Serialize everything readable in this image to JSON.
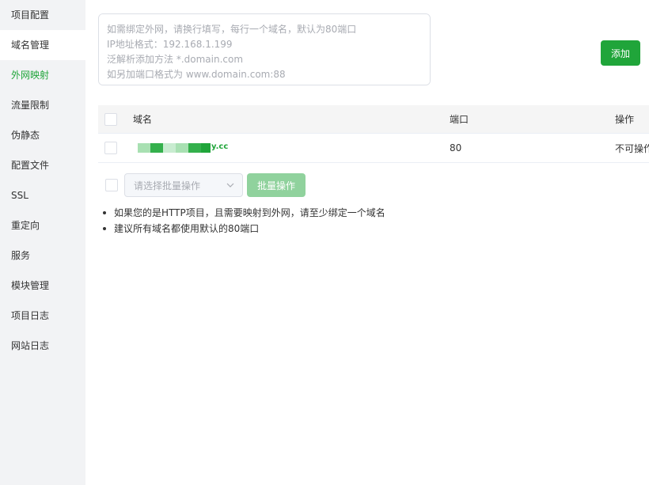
{
  "sidebar": {
    "items": [
      {
        "label": "项目配置"
      },
      {
        "label": "域名管理"
      },
      {
        "label": "外网映射"
      },
      {
        "label": "流量限制"
      },
      {
        "label": "伪静态"
      },
      {
        "label": "配置文件"
      },
      {
        "label": "SSL"
      },
      {
        "label": "重定向"
      },
      {
        "label": "服务"
      },
      {
        "label": "模块管理"
      },
      {
        "label": "项目日志"
      },
      {
        "label": "网站日志"
      }
    ],
    "selected_item": "域名管理",
    "highlighted_item": "外网映射"
  },
  "domain_input": {
    "placeholder": "如需绑定外网，请换行填写，每行一个域名，默认为80端口\nIP地址格式：192.168.1.199\n泛解析添加方法 *.domain.com\n如另加端口格式为 www.domain.com:88",
    "value": ""
  },
  "add_button": {
    "label": "添加"
  },
  "table": {
    "columns": {
      "domain": "域名",
      "port": "端口",
      "action": "操作"
    },
    "rows": [
      {
        "domain_suffix": "y.cc",
        "port": "80",
        "action": "不可操作"
      }
    ]
  },
  "batch": {
    "select_placeholder": "请选择批量操作",
    "button_label": "批量操作"
  },
  "tips": [
    "如果您的是HTTP项目，且需要映射到外网，请至少绑定一个域名",
    "建议所有域名都使用默认的80端口"
  ],
  "colors": {
    "accent_green": "#20a53a",
    "disabled_green": "#90d29d",
    "sidebar_bg": "#f2f3f5",
    "table_header_bg": "#f5f5f5"
  }
}
